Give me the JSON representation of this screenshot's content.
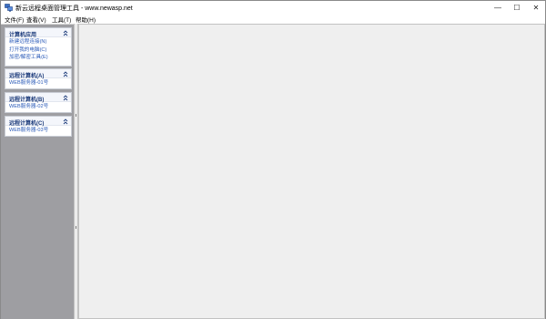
{
  "window": {
    "title": "新云远程桌面管理工具 - www.newasp.net",
    "controls": {
      "minimize": "—",
      "maximize": "☐",
      "close": "✕"
    }
  },
  "menu": [
    {
      "label": "文件(F)"
    },
    {
      "label": "查看(V)"
    },
    {
      "label": "工具(T)"
    },
    {
      "label": "帮助(H)"
    }
  ],
  "sidebar": {
    "panels": [
      {
        "title": "计算机应用",
        "collapse_icon": "double-chevron-up-icon",
        "items": [
          {
            "label": "新建远程连接(N)"
          },
          {
            "label": "打开我的电脑(C)"
          },
          {
            "label": "加密/解密工具(E)"
          }
        ]
      },
      {
        "title": "远程计算机(A)",
        "collapse_icon": "double-chevron-up-icon",
        "items": [
          {
            "label": "WEB服务器-01号"
          }
        ]
      },
      {
        "title": "远程计算机(B)",
        "collapse_icon": "double-chevron-up-icon",
        "items": [
          {
            "label": "WEB服务器-02号"
          }
        ]
      },
      {
        "title": "远程计算机(C)",
        "collapse_icon": "double-chevron-up-icon",
        "items": [
          {
            "label": "WEB服务器-03号"
          }
        ]
      }
    ]
  },
  "colors": {
    "sidebar_bg": "#9e9ea2",
    "panel_title": "#1b3a7a",
    "link": "#2b5bb8",
    "workspace_bg": "#efefef"
  }
}
